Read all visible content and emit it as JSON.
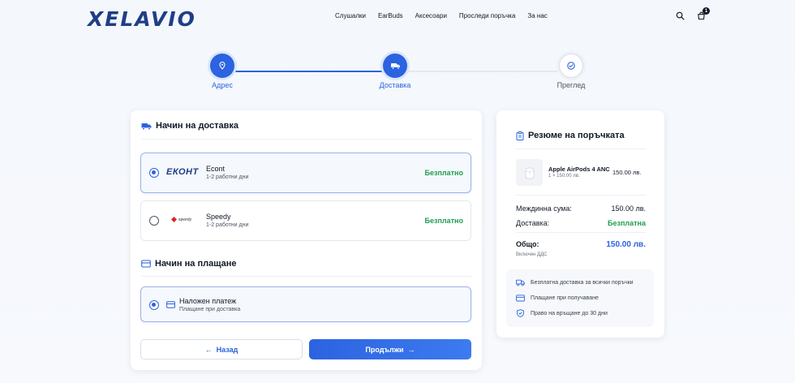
{
  "brand": {
    "logo_text": "XELAVIO",
    "accent": "#2b63e0"
  },
  "nav": {
    "items": [
      "Слушалки",
      "EarBuds",
      "Аксесоари",
      "Проследи поръчка",
      "За нас"
    ]
  },
  "header": {
    "cart_count": "1",
    "search_icon": "search-icon",
    "cart_icon": "cart-icon"
  },
  "stepper": {
    "steps": [
      {
        "label": "Адрес",
        "icon": "map-pin-icon",
        "state": "done"
      },
      {
        "label": "Доставка",
        "icon": "truck-icon",
        "state": "active"
      },
      {
        "label": "Преглед",
        "icon": "check-badge-icon",
        "state": "pending"
      }
    ]
  },
  "delivery": {
    "title": "Начин на доставка",
    "options": [
      {
        "logo_text": "ЕКОНТ",
        "name": "Econt",
        "eta": "1-2 работни дни",
        "price": "Безплатно",
        "selected": true
      },
      {
        "logo_text": "speedy",
        "name": "Speedy",
        "eta": "1-2 работни дни",
        "price": "Безплатно",
        "selected": false
      }
    ]
  },
  "payment": {
    "title": "Начин на плащане",
    "options": [
      {
        "name": "Наложен платеж",
        "desc": "Плащане при доставка",
        "selected": true
      }
    ]
  },
  "actions": {
    "back_label": "Назад",
    "next_label": "Продължи"
  },
  "summary": {
    "title": "Резюме на поръчката",
    "item": {
      "name": "Apple AirPods 4 ANC",
      "qty_line": "1 × 150.00 лв.",
      "price": "150.00 лв."
    },
    "subtotal_label": "Междинна сума:",
    "subtotal_value": "150.00 лв.",
    "shipping_label": "Доставка:",
    "shipping_value": "Безплатна",
    "total_label": "Общо:",
    "total_value": "150.00 лв.",
    "vat_note": "Включен ДДС",
    "perks": [
      "Безплатна доставка за всички поръчки",
      "Плащане при получаване",
      "Право на връщане до 30 дни"
    ]
  }
}
